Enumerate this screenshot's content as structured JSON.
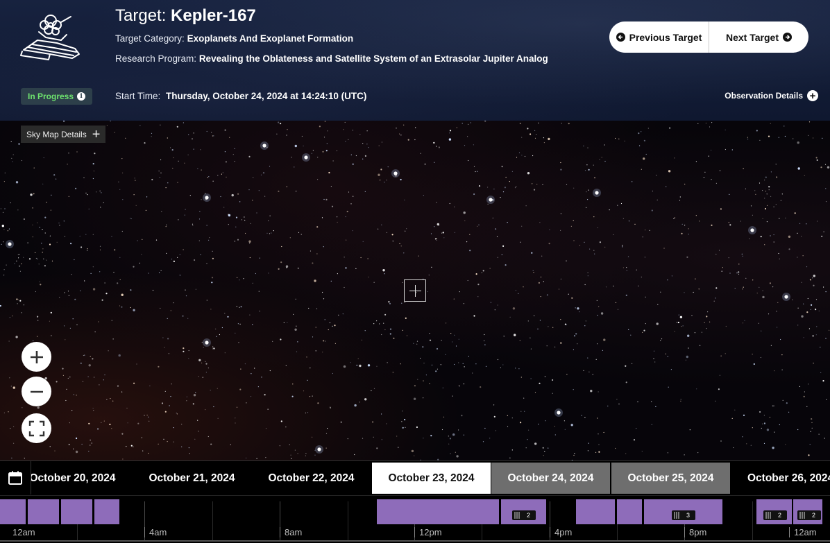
{
  "header": {
    "target_label": "Target:",
    "target_name": "Kepler-167",
    "category_label": "Target Category:",
    "category_value": "Exoplanets And Exoplanet Formation",
    "program_label": "Research Program:",
    "program_value": "Revealing the Oblateness and Satellite System of an Extrasolar Jupiter Analog",
    "status": "In Progress",
    "start_label": "Start Time:",
    "start_value": "Thursday, October 24, 2024 at 14:24:10 (UTC)",
    "prev_label": "Previous Target",
    "next_label": "Next Target",
    "observation_details_label": "Observation Details"
  },
  "skymap": {
    "details_label": "Sky Map Details"
  },
  "dates": [
    {
      "label": "October 20, 2024",
      "state": "normal"
    },
    {
      "label": "October 21, 2024",
      "state": "normal"
    },
    {
      "label": "October 22, 2024",
      "state": "normal"
    },
    {
      "label": "October 23, 2024",
      "state": "active"
    },
    {
      "label": "October 24, 2024",
      "state": "observed"
    },
    {
      "label": "October 25, 2024",
      "state": "observed"
    },
    {
      "label": "October 26, 2024",
      "state": "normal"
    }
  ],
  "timeline": {
    "labels": [
      "12am",
      "4am",
      "8am",
      "12pm",
      "4pm",
      "8pm",
      "12am"
    ],
    "badges": [
      "2",
      "3",
      "2",
      "2"
    ]
  },
  "colors": {
    "header_bg": "#121c36",
    "status_green": "#6ee46e",
    "observation_purple": "#8e6cba",
    "observed_date_gray": "#6e6e6e"
  },
  "icons": {
    "logo": "telescope-logo-icon",
    "prev": "arrow-left-circle-icon",
    "next": "arrow-right-circle-icon",
    "info": "info-icon",
    "observation_details": "plus-circle-icon",
    "zoom_in": "zoom-in-icon",
    "zoom_out": "zoom-out-icon",
    "fullscreen": "fullscreen-icon",
    "calendar": "calendar-icon"
  }
}
